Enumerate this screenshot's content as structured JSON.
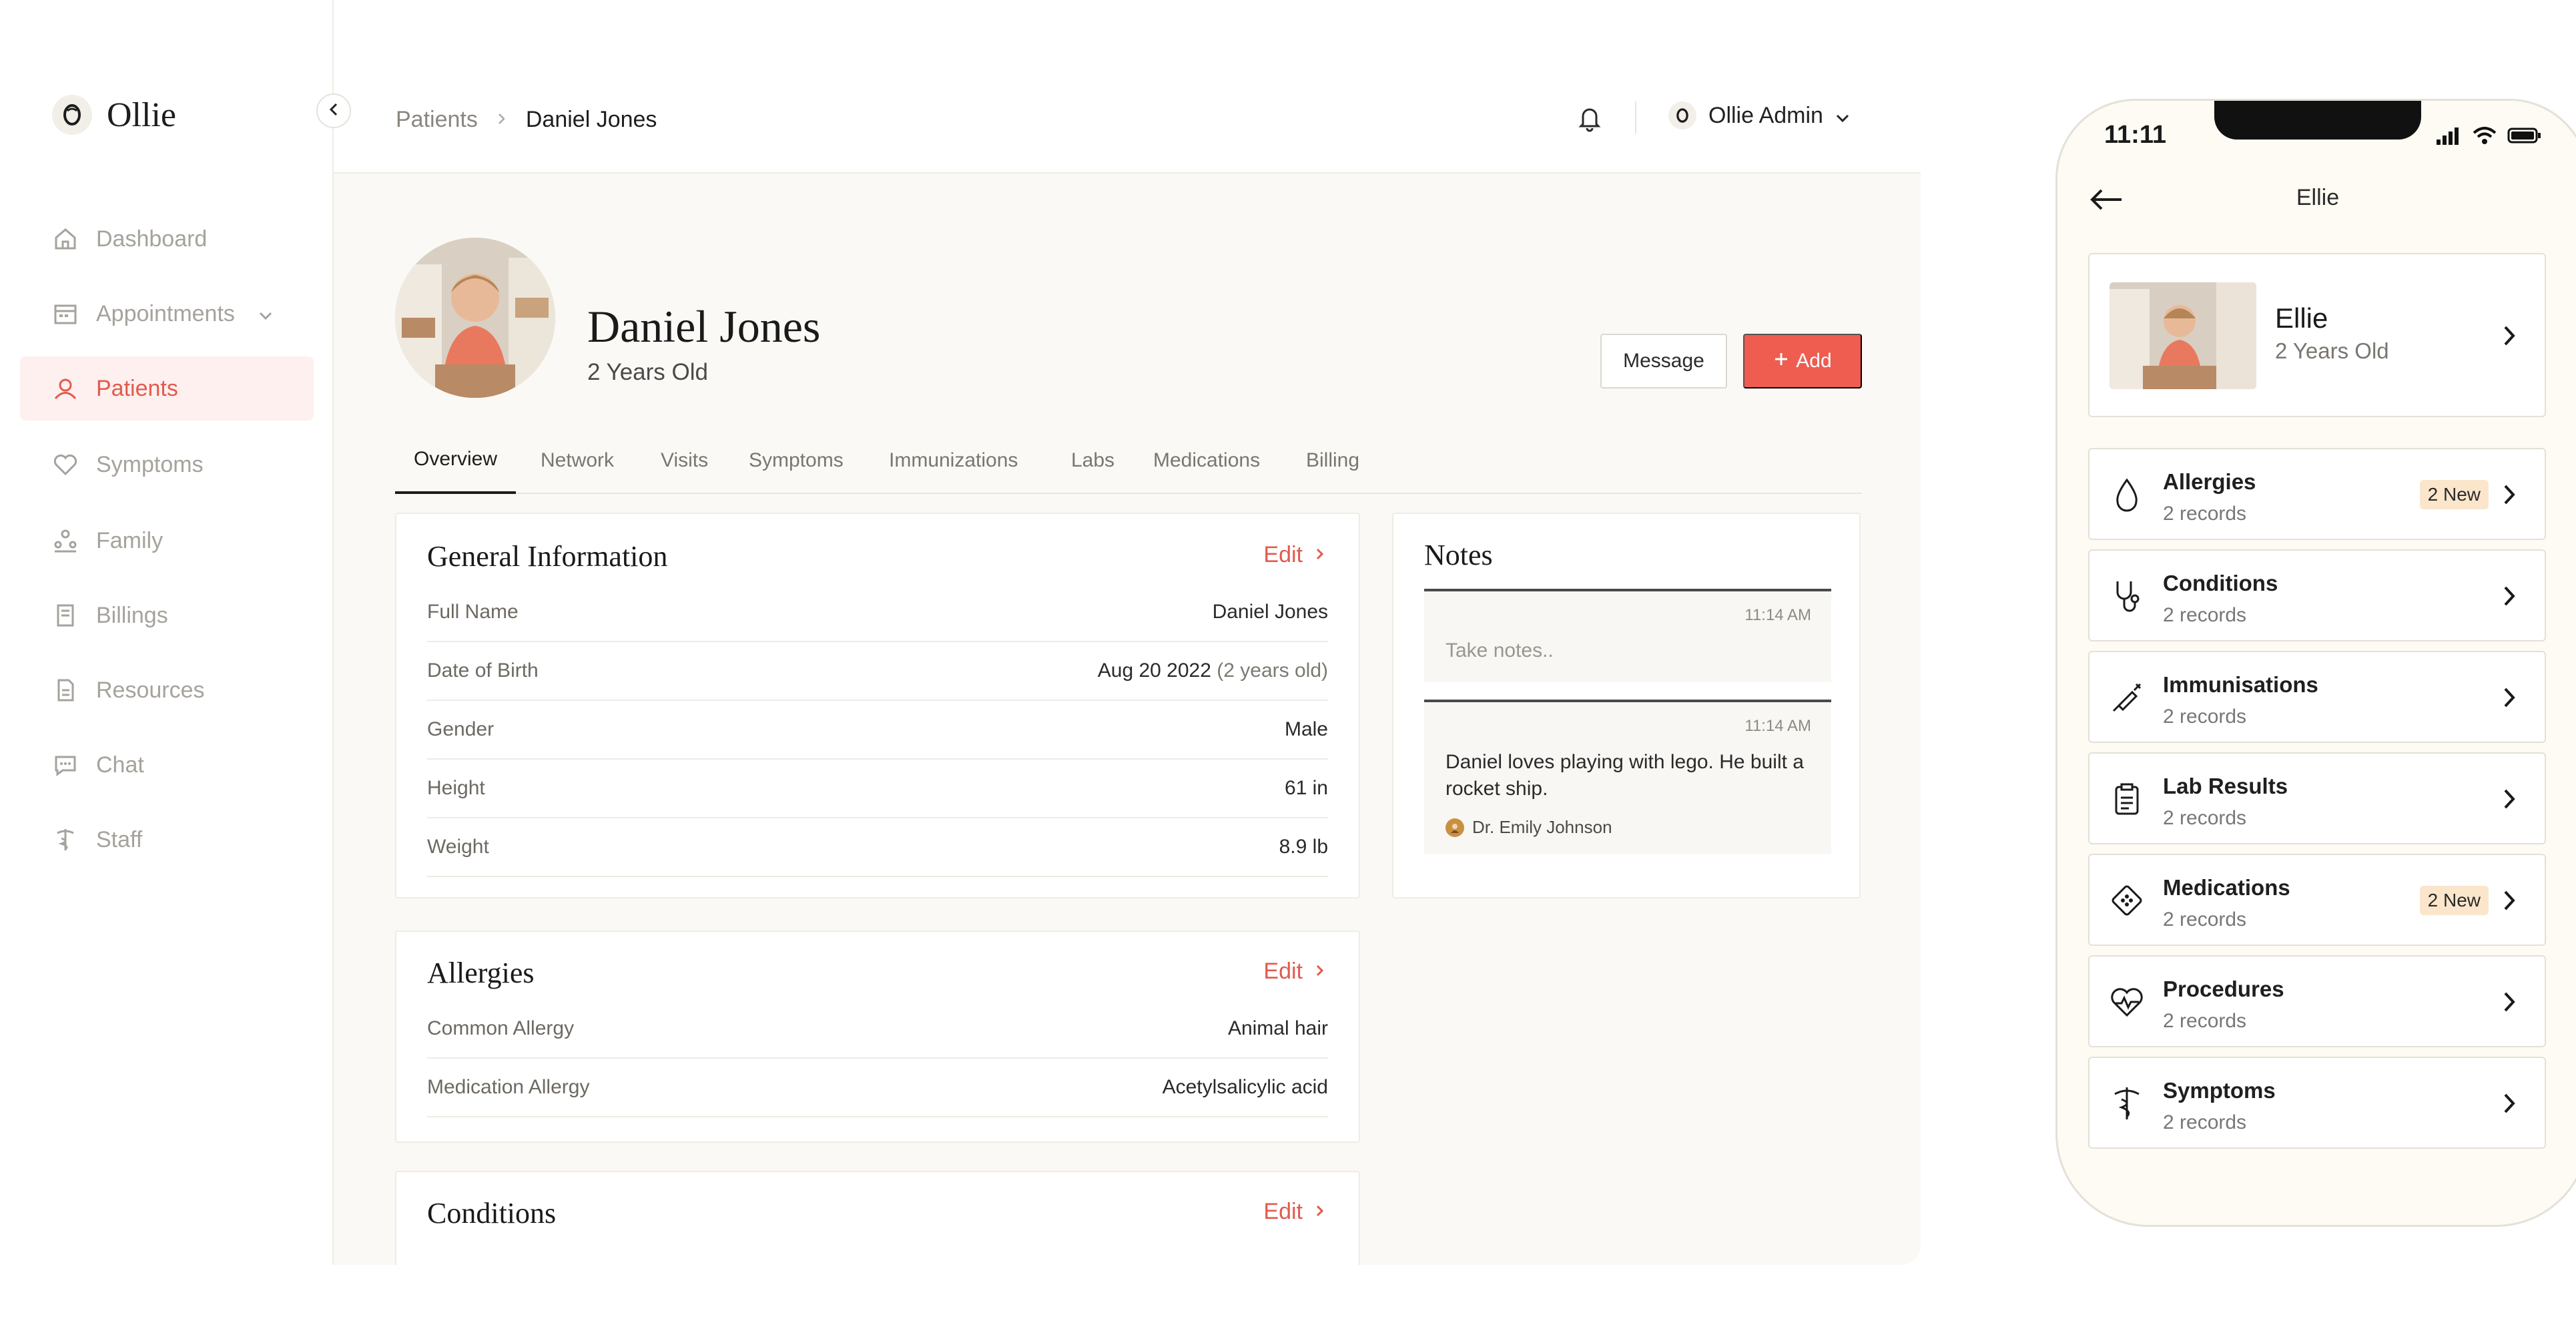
{
  "brand": {
    "name": "Ollie"
  },
  "sidebar": {
    "items": [
      {
        "label": "Dashboard",
        "icon": "home-icon",
        "active": false
      },
      {
        "label": "Appointments",
        "icon": "calendar-icon",
        "active": false,
        "has_caret": true
      },
      {
        "label": "Patients",
        "icon": "patients-icon",
        "active": true
      },
      {
        "label": "Symptoms",
        "icon": "heart-icon",
        "active": false
      },
      {
        "label": "Family",
        "icon": "family-icon",
        "active": false
      },
      {
        "label": "Billings",
        "icon": "billing-icon",
        "active": false
      },
      {
        "label": "Resources",
        "icon": "document-icon",
        "active": false
      },
      {
        "label": "Chat",
        "icon": "chat-icon",
        "active": false
      },
      {
        "label": "Staff",
        "icon": "caduceus-icon",
        "active": false
      }
    ]
  },
  "header": {
    "breadcrumb": {
      "parent": "Patients",
      "current": "Daniel Jones"
    },
    "account": "Ollie Admin"
  },
  "patient": {
    "name": "Daniel Jones",
    "age": "2 Years Old",
    "message_label": "Message",
    "add_label": "Add"
  },
  "tabs": [
    "Overview",
    "Network",
    "Visits",
    "Symptoms",
    "Immunizations",
    "Labs",
    "Medications",
    "Billing"
  ],
  "general_info": {
    "title": "General Information",
    "edit": "Edit",
    "rows": [
      {
        "label": "Full Name",
        "value": "Daniel Jones",
        "extra": ""
      },
      {
        "label": "Date of Birth",
        "value": "Aug 20 2022",
        "extra": "(2 years old)"
      },
      {
        "label": "Gender",
        "value": "Male",
        "extra": ""
      },
      {
        "label": "Height",
        "value": "61 in",
        "extra": ""
      },
      {
        "label": "Weight",
        "value": "8.9 lb",
        "extra": ""
      }
    ]
  },
  "allergies": {
    "title": "Allergies",
    "edit": "Edit",
    "rows": [
      {
        "label": "Common Allergy",
        "value": "Animal hair"
      },
      {
        "label": "Medication Allergy",
        "value": "Acetylsalicylic acid"
      }
    ]
  },
  "conditions": {
    "title": "Conditions",
    "edit": "Edit"
  },
  "notes": {
    "title": "Notes",
    "input": {
      "time": "11:14 AM",
      "placeholder": "Take notes.."
    },
    "entry": {
      "time": "11:14 AM",
      "text": "Daniel loves playing with lego. He built a rocket ship.",
      "author": "Dr. Emily Johnson"
    }
  },
  "phone": {
    "time": "11:11",
    "title": "Ellie",
    "profile": {
      "name": "Ellie",
      "age": "2 Years Old"
    },
    "records": [
      {
        "title": "Allergies",
        "sub": "2 records",
        "badge": "2 New",
        "icon": "drop-icon"
      },
      {
        "title": "Conditions",
        "sub": "2 records",
        "badge": "",
        "icon": "stethoscope-icon"
      },
      {
        "title": "Immunisations",
        "sub": "2 records",
        "badge": "",
        "icon": "syringe-icon"
      },
      {
        "title": "Lab Results",
        "sub": "2 records",
        "badge": "",
        "icon": "clipboard-icon"
      },
      {
        "title": "Medications",
        "sub": "2 records",
        "badge": "2 New",
        "icon": "pill-pack-icon"
      },
      {
        "title": "Procedures",
        "sub": "2 records",
        "badge": "",
        "icon": "heart-pulse-icon"
      },
      {
        "title": "Symptoms",
        "sub": "2 records",
        "badge": "",
        "icon": "caduceus-icon"
      }
    ]
  },
  "colors": {
    "accent": "#ee5d50",
    "active_bg": "#fdf0ee",
    "main_bg": "#fbf9f5",
    "badge_bg": "#fbe6cc",
    "phone_bg": "#fdfbf3"
  }
}
